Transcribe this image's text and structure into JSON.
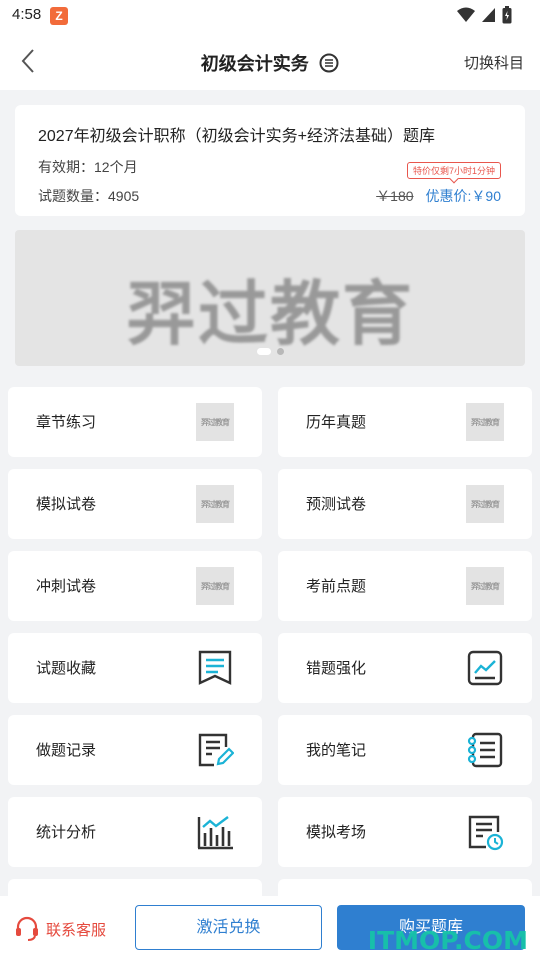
{
  "status_bar": {
    "time": "4:58",
    "app_icon_glyph": "Z"
  },
  "header": {
    "title": "初级会计实务",
    "switch_label": "切换科目"
  },
  "product": {
    "title": "2027年初级会计职称（初级会计实务+经济法基础）题库",
    "validity": "有效期：12个月",
    "count": "试题数量：4905",
    "promo_tag": "特价仅剩7小时1分钟",
    "old_price": "￥180",
    "discount_price": "优惠价:￥90"
  },
  "banner": {
    "text": "羿过教育",
    "slide_count": 2,
    "active_slide": 1
  },
  "tiles": [
    {
      "label": "章节练习",
      "icon": "brand-placeholder-icon"
    },
    {
      "label": "历年真题",
      "icon": "brand-placeholder-icon"
    },
    {
      "label": "模拟试卷",
      "icon": "brand-placeholder-icon"
    },
    {
      "label": "预测试卷",
      "icon": "brand-placeholder-icon"
    },
    {
      "label": "冲刺试卷",
      "icon": "brand-placeholder-icon"
    },
    {
      "label": "考前点题",
      "icon": "brand-placeholder-icon"
    },
    {
      "label": "试题收藏",
      "icon": "bookmark-icon"
    },
    {
      "label": "错题强化",
      "icon": "chart-board-icon"
    },
    {
      "label": "做题记录",
      "icon": "edit-document-icon"
    },
    {
      "label": "我的笔记",
      "icon": "notebook-icon"
    },
    {
      "label": "统计分析",
      "icon": "bar-chart-icon"
    },
    {
      "label": "模拟考场",
      "icon": "exam-timer-icon"
    }
  ],
  "placeholder_icon_text": "羿过教育",
  "bottom": {
    "service_label": "联系客服",
    "activate_label": "激活兑换",
    "buy_label": "购买题库"
  },
  "watermark": "ITMOP.COM",
  "colors": {
    "accent": "#2f7fd0",
    "service": "#e54a3e",
    "icon_teal": "#1bb3d6",
    "watermark": "#16c3a8"
  }
}
